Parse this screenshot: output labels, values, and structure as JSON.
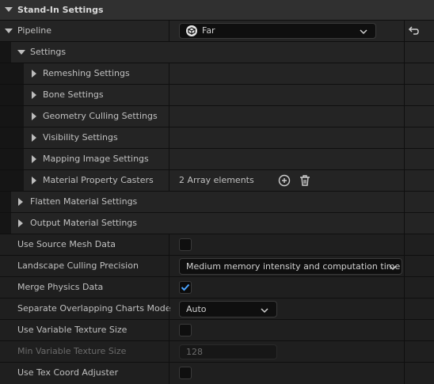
{
  "section": {
    "title": "Stand-In Settings"
  },
  "pipeline": {
    "label": "Pipeline",
    "value": "Far",
    "reset_icon": "reset-arrow-icon"
  },
  "settings": {
    "label": "Settings",
    "items": [
      {
        "label": "Remeshing Settings"
      },
      {
        "label": "Bone Settings"
      },
      {
        "label": "Geometry Culling Settings"
      },
      {
        "label": "Visibility Settings"
      },
      {
        "label": "Mapping Image Settings"
      },
      {
        "label": "Material Property Casters",
        "value": "2 Array elements"
      }
    ]
  },
  "groups": [
    {
      "label": "Flatten Material Settings"
    },
    {
      "label": "Output Material Settings"
    }
  ],
  "properties": {
    "use_source_mesh": {
      "label": "Use Source Mesh Data",
      "checked": false
    },
    "landscape_culling": {
      "label": "Landscape Culling Precision",
      "value": "Medium memory intensity and computation time"
    },
    "merge_physics": {
      "label": "Merge Physics Data",
      "checked": true
    },
    "separate_charts": {
      "label": "Separate Overlapping Charts Mode",
      "value": "Auto"
    },
    "use_variable_texture": {
      "label": "Use Variable Texture Size",
      "checked": false
    },
    "min_variable_texture": {
      "label": "Min Variable Texture Size",
      "value": "128"
    },
    "use_tex_coord": {
      "label": "Use Tex Coord Adjuster",
      "checked": false
    }
  },
  "colors": {
    "accent": "#4aa3ff",
    "background": "#1a1a1a"
  }
}
